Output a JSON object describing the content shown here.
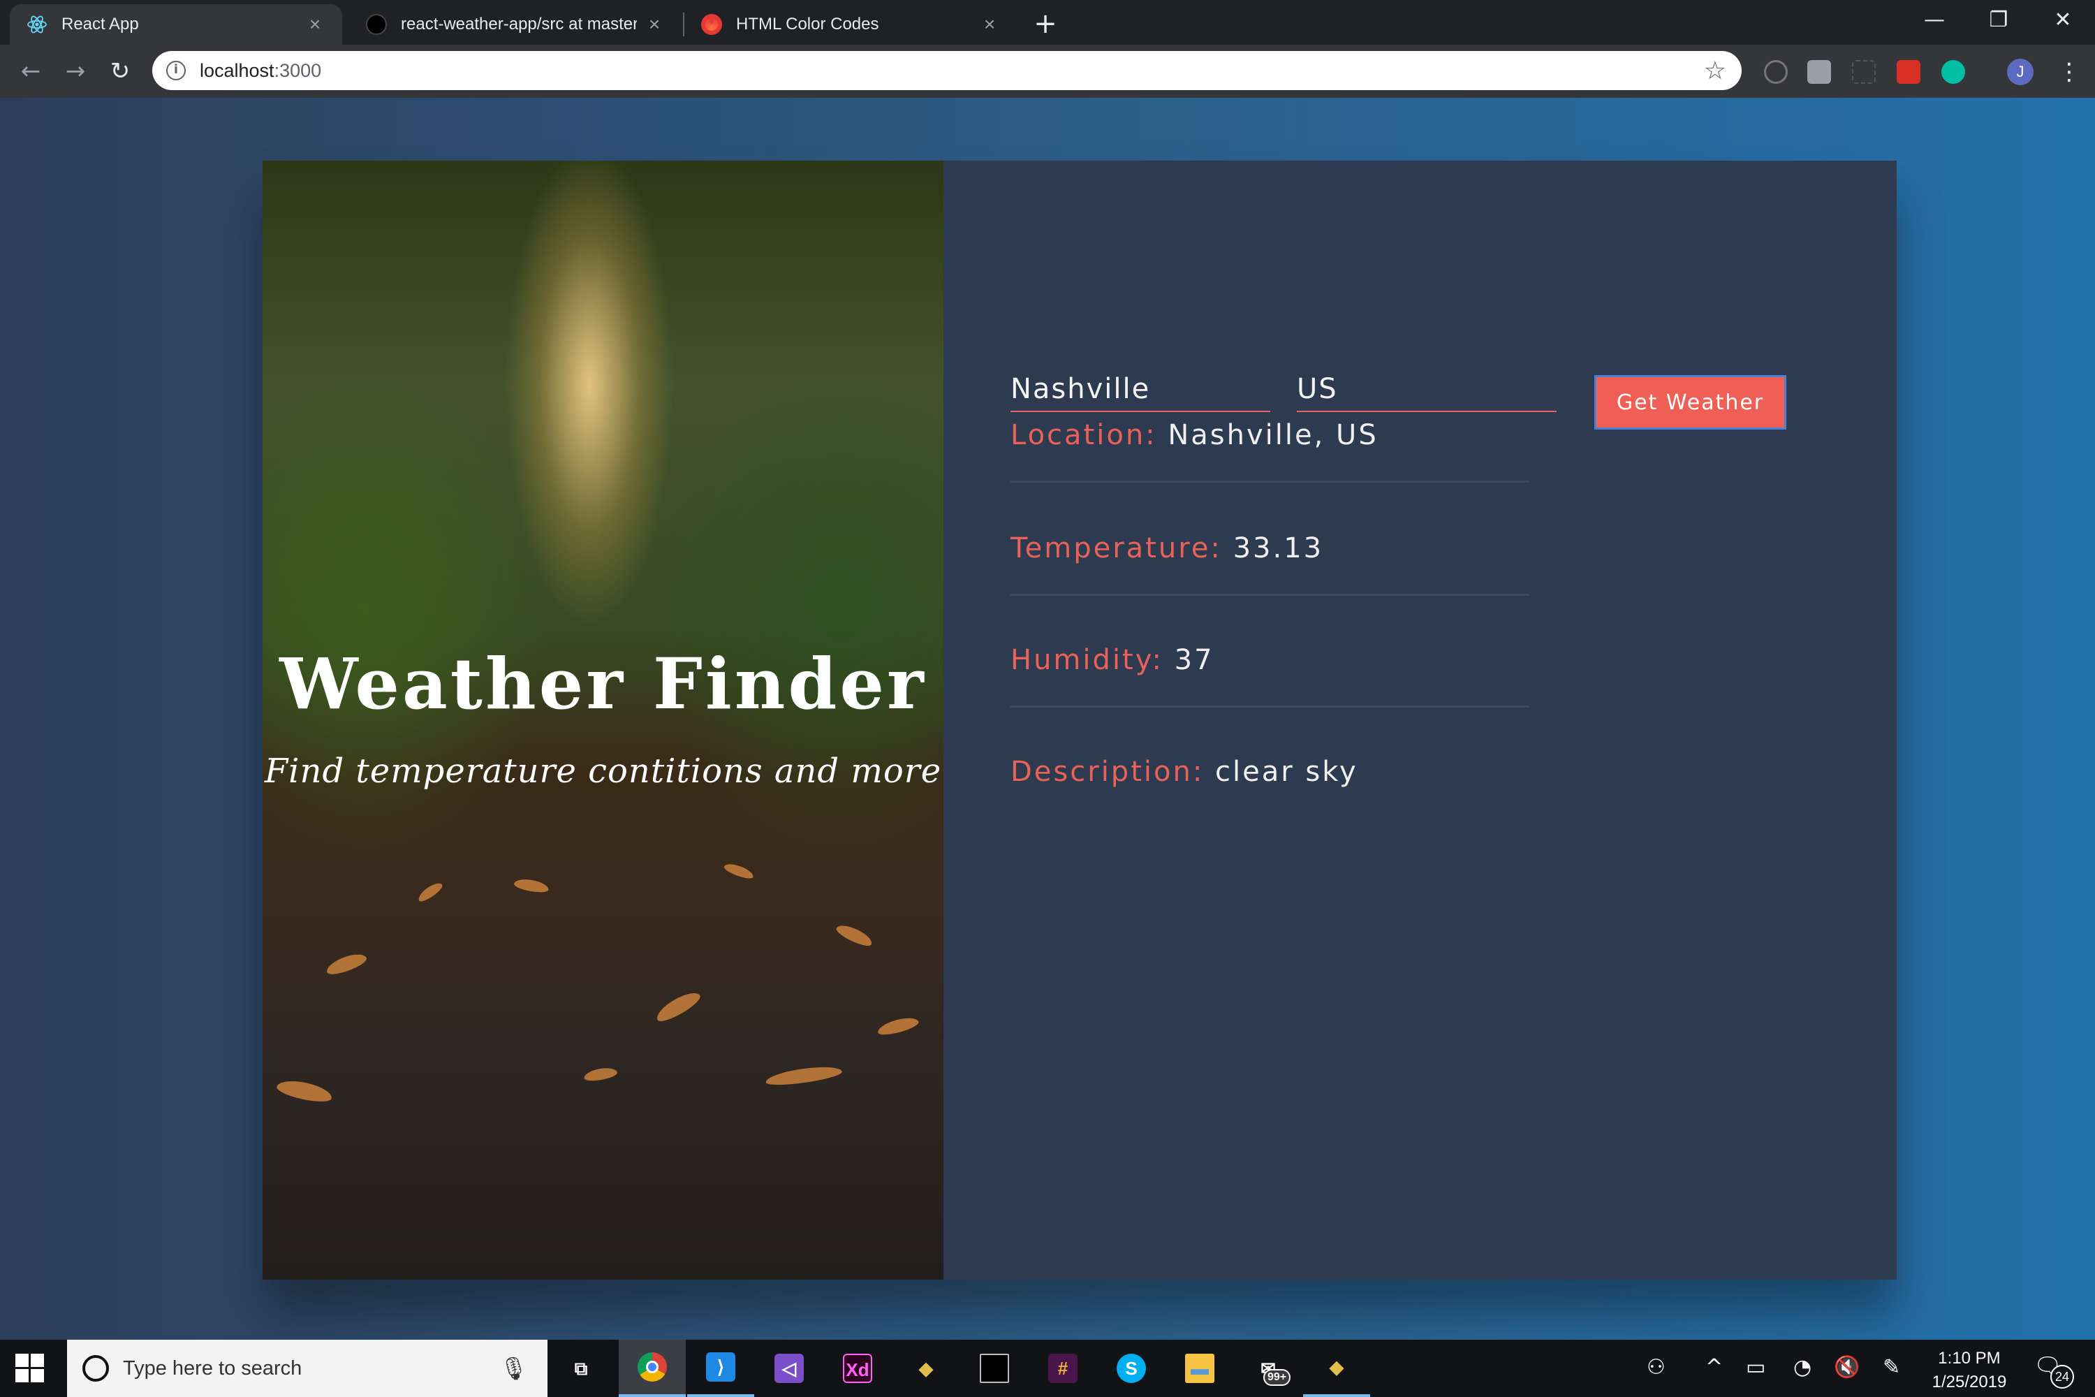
{
  "browser": {
    "tabs": [
      {
        "label": "React App",
        "close": "×",
        "active": true
      },
      {
        "label": "react-weather-app/src at master",
        "close": "×",
        "active": false
      },
      {
        "label": "HTML Color Codes",
        "close": "×",
        "active": false
      }
    ],
    "new_tab": "+",
    "window_controls": {
      "minimize": "—",
      "restore": "❐",
      "close": "✕"
    },
    "nav": {
      "back": "←",
      "forward": "→",
      "reload": "↻"
    },
    "address": {
      "host": "localhost",
      "port": ":3000",
      "info": "i"
    },
    "bookmark_star": "☆",
    "profile_initial": "J"
  },
  "app": {
    "hero": {
      "title": "Weather Finder",
      "subtitle": "Find temperature contitions and more"
    },
    "form": {
      "city_value": "Nashville",
      "country_value": "US",
      "button_label": "Get Weather"
    },
    "results": [
      {
        "key": "Location:",
        "value": "Nashville, US"
      },
      {
        "key": "Temperature:",
        "value": "33.13"
      },
      {
        "key": "Humidity:",
        "value": "37"
      },
      {
        "key": "Description:",
        "value": "clear sky"
      }
    ],
    "colors": {
      "accent": "#ef5f55",
      "panel": "#2d3a50"
    }
  },
  "taskbar": {
    "search_placeholder": "Type here to search",
    "mic": "🎙",
    "apps": [
      {
        "name": "task-view",
        "glyph": "⧉"
      },
      {
        "name": "chrome",
        "glyph": ""
      },
      {
        "name": "vscode",
        "glyph": "⟩"
      },
      {
        "name": "visual-studio",
        "glyph": "◁"
      },
      {
        "name": "adobe-xd",
        "glyph": "Xd"
      },
      {
        "name": "git-tool",
        "glyph": "◆"
      },
      {
        "name": "terminal",
        "glyph": ""
      },
      {
        "name": "slack",
        "glyph": "#"
      },
      {
        "name": "skype",
        "glyph": "S"
      },
      {
        "name": "file-explorer",
        "glyph": "▬"
      },
      {
        "name": "mail",
        "glyph": "✉",
        "badge": "99+"
      },
      {
        "name": "git-tool-2",
        "glyph": "◆"
      }
    ],
    "tray": {
      "people": "⚇",
      "chevron": "^",
      "battery": "▭",
      "wifi": "◔",
      "volume": "🔇",
      "pen": "✎"
    },
    "time": "1:10 PM",
    "date": "1/25/2019",
    "notifications": "24"
  }
}
